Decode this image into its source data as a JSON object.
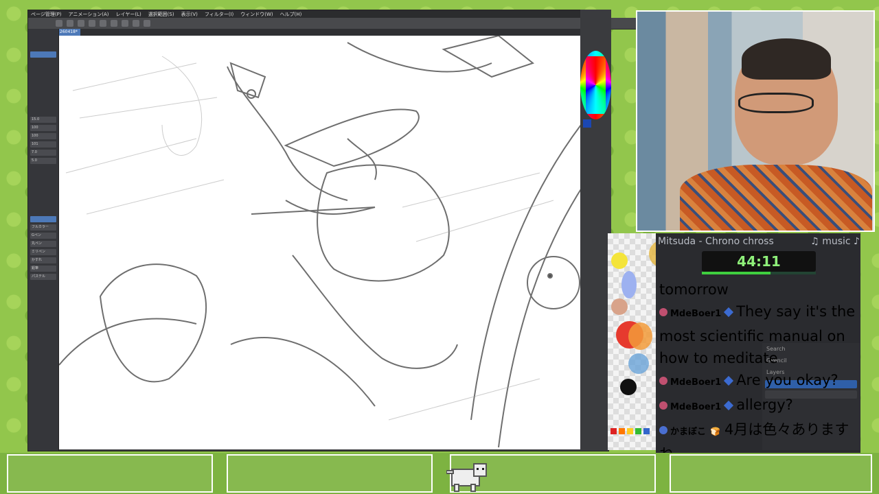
{
  "app": {
    "menu": [
      "ページ管理(P)",
      "アニメーション(A)",
      "レイヤー(L)",
      "選択範囲(S)",
      "表示(V)",
      "フィルター(I)",
      "ウィンドウ(W)",
      "ヘルプ(H)"
    ],
    "doc_tab": "260418*"
  },
  "left_panel": {
    "rows": [
      "15.0",
      "100",
      "100",
      "101",
      "7.0",
      "5.0",
      "",
      "",
      "フルカラー",
      "Gペン",
      "丸ペン",
      "ミリペン",
      "かすれ",
      "鉛筆",
      "パステル"
    ]
  },
  "chat": {
    "now_playing": "Mitsuda - Chrono chross",
    "music_label": "♫ music ♪",
    "timer": "44:11",
    "messages": [
      {
        "user": "",
        "text": "tomorrow"
      },
      {
        "user": "MdeBoer1",
        "text": "They say it's the most scientific manual on how to meditate"
      },
      {
        "user": "MdeBoer1",
        "text": "Are you okay?"
      },
      {
        "user": "MdeBoer1",
        "text": "allergy?"
      },
      {
        "user": "かまぼこ",
        "text": "4月は色々あります ね"
      }
    ]
  },
  "layers_panel": {
    "search": "Search",
    "layer_name": "GPencil",
    "header": "Layers"
  },
  "colors": {
    "accent": "#4d79b8",
    "timer_green": "#8ff07a",
    "chat_bg": "#2a2b2f",
    "background": "#92c64c"
  }
}
